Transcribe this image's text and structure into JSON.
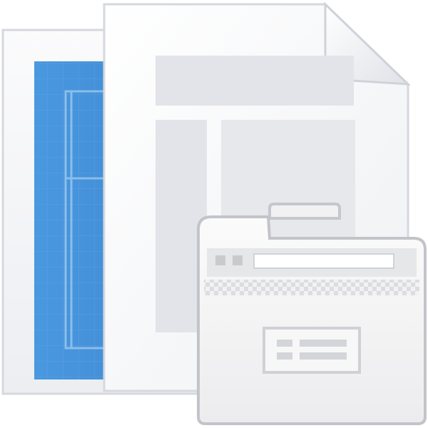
{
  "icon": {
    "name": "document-template-browser-icon",
    "colors": {
      "blueprint": "#3f90d8",
      "blueprint_dark": "#2f78c2",
      "paper": "#f7f7f8",
      "paper_edge": "#d9dbe0",
      "placeholder": "#e3e5ea",
      "window_frame": "#c4c6cb",
      "window_body": "#f4f4f5",
      "window_toolbar": "#e6e7e9"
    }
  }
}
